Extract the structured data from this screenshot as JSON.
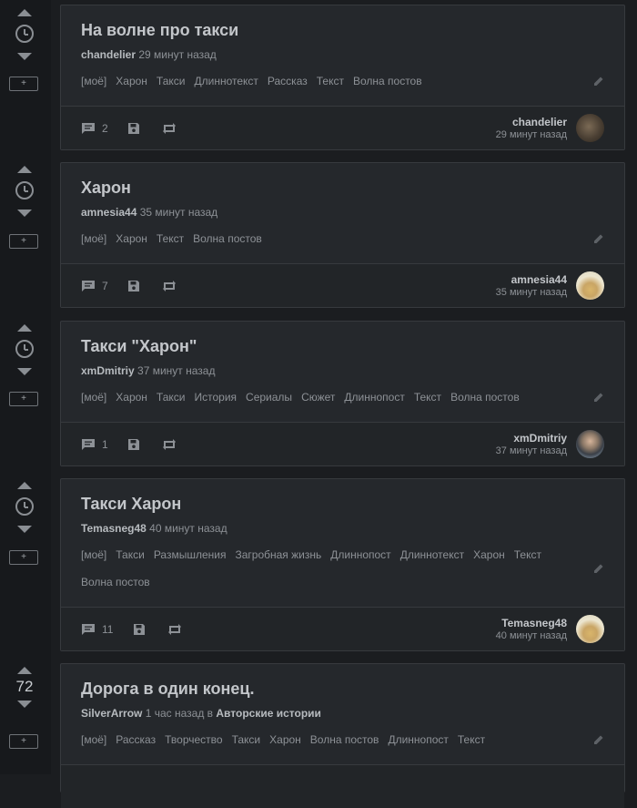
{
  "posts": [
    {
      "title": "На волне про такси",
      "author": "chandelier",
      "time": "29 минут назад",
      "rating_display": "",
      "community": "",
      "tags": [
        "[моё]",
        "Харон",
        "Такси",
        "Длиннотекст",
        "Рассказ",
        "Текст",
        "Волна постов"
      ],
      "comments": "2",
      "avatar_colors": [
        "#6a5a48",
        "#2f2a22"
      ]
    },
    {
      "title": "Харон",
      "author": "amnesia44",
      "time": "35 минут назад",
      "rating_display": "",
      "community": "",
      "tags": [
        "[моё]",
        "Харон",
        "Текст",
        "Волна постов"
      ],
      "comments": "7",
      "avatar_colors": [
        "#e9e2c8",
        "#c7a35a"
      ]
    },
    {
      "title": "Такси \"Харон\"",
      "author": "xmDmitriy",
      "time": "37 минут назад",
      "rating_display": "",
      "community": "",
      "tags": [
        "[моё]",
        "Харон",
        "Такси",
        "История",
        "Сериалы",
        "Сюжет",
        "Длиннопост",
        "Текст",
        "Волна постов"
      ],
      "comments": "1",
      "avatar_colors": [
        "#9ab3c8",
        "#4a4e55"
      ]
    },
    {
      "title": "Такси Харон",
      "author": "Temasneg48",
      "time": "40 минут назад",
      "rating_display": "",
      "community": "",
      "tags": [
        "[моё]",
        "Такси",
        "Размышления",
        "Загробная жизнь",
        "Длиннопост",
        "Длиннотекст",
        "Харон",
        "Текст",
        "Волна постов"
      ],
      "comments": "11",
      "avatar_colors": [
        "#e9e2c8",
        "#c7a35a"
      ]
    },
    {
      "title": "Дорога в один конец.",
      "author": "SilverArrow",
      "time": "1 час назад",
      "in_word": "в",
      "rating_display": "72",
      "community": "Авторские истории",
      "tags": [
        "[моё]",
        "Рассказ",
        "Творчество",
        "Такси",
        "Харон",
        "Волна постов",
        "Длиннопост",
        "Текст"
      ],
      "comments": "",
      "avatar_colors": [
        "#333",
        "#222"
      ]
    }
  ],
  "icons": {
    "up": "arrow-up-icon",
    "down": "arrow-down-icon",
    "clock": "clock-icon",
    "add": "plus-icon",
    "comment": "comment-icon",
    "save": "floppy-icon",
    "share": "repost-icon",
    "edit": "pencil-icon"
  },
  "colors": {
    "background": "#1b1d20",
    "card": "#25282c",
    "border": "#373a3e",
    "text": "#9a9ea3",
    "title": "#c3c6ca"
  }
}
